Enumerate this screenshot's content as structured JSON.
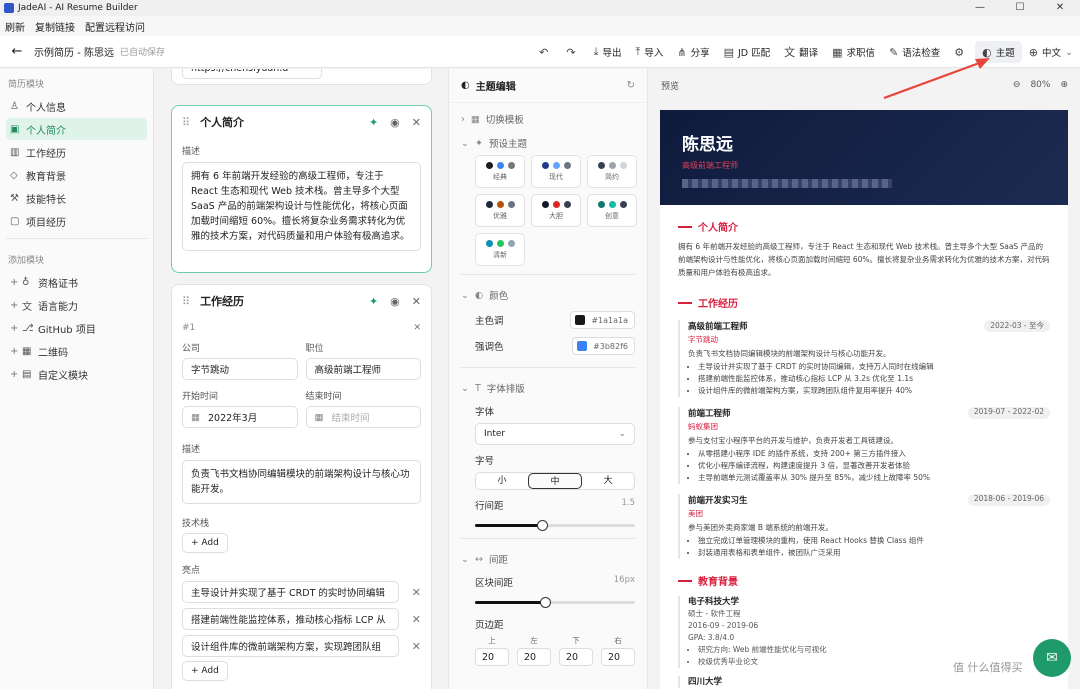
{
  "app": {
    "title": "JadeAI - AI Resume Builder",
    "menu": [
      "刷新",
      "复制链接",
      "配置远程访问"
    ]
  },
  "toolbar": {
    "doc_title": "示例简历 - 陈思远",
    "saved": "已自动保存",
    "undo_icon": "undo-icon",
    "redo_icon": "redo-icon",
    "buttons": [
      {
        "label": "导出",
        "icon": "export-icon"
      },
      {
        "label": "导入",
        "icon": "import-icon"
      },
      {
        "label": "分享",
        "icon": "share-icon"
      },
      {
        "label": "JD 匹配",
        "icon": "jd-match-icon"
      },
      {
        "label": "翻译",
        "icon": "translate-icon"
      },
      {
        "label": "求职信",
        "icon": "cover-letter-icon"
      },
      {
        "label": "语法检查",
        "icon": "grammar-icon"
      }
    ],
    "settings_icon": "settings-icon",
    "theme_label": "主题",
    "lang_label": "中文"
  },
  "sidebar": {
    "section1": "简历模块",
    "items": [
      "个人信息",
      "个人简介",
      "工作经历",
      "教育背景",
      "技能特长",
      "项目经历"
    ],
    "section2": "添加模块",
    "add_items": [
      "资格证书",
      "语言能力",
      "GitHub 项目",
      "二维码",
      "自定义模块"
    ]
  },
  "editor": {
    "top_input": "https://chensiyuan.d",
    "summary": {
      "title": "个人简介",
      "desc_label": "描述",
      "text": "拥有 6 年前端开发经验的高级工程师，专注于 React 生态和现代 Web 技术栈。曾主导多个大型 SaaS 产品的前端架构设计与性能优化，将核心页面加载时间缩短 60%。擅长将复杂业务需求转化为优雅的技术方案，对代码质量和用户体验有极高追求。"
    },
    "work": {
      "title": "工作经历",
      "index": "#1",
      "company_label": "公司",
      "company": "字节跳动",
      "position_label": "职位",
      "position": "高级前端工程师",
      "start_label": "开始时间",
      "start": "2022年3月",
      "end_label": "结束时间",
      "end_placeholder": "结束时间",
      "desc_label": "描述",
      "desc": "负责飞书文档协同编辑模块的前端架构设计与核心功能开发。",
      "tech_label": "技术栈",
      "add": "+ Add",
      "hl_label": "亮点",
      "highlights": [
        "主导设计并实现了基于 CRDT 的实时协同编辑",
        "搭建前端性能监控体系，推动核心指标 LCP 从",
        "设计组件库的微前端架构方案，实现跨团队组"
      ],
      "add2": "+ Add"
    }
  },
  "theme": {
    "title": "主题编辑",
    "switch_template": "切换模板",
    "preset_title": "预设主题",
    "presets": [
      {
        "name": "经典",
        "colors": [
          "#1a1a1a",
          "#3b82f6",
          "#777777"
        ]
      },
      {
        "name": "现代",
        "colors": [
          "#1e3a8a",
          "#60a5fa",
          "#6b7280"
        ]
      },
      {
        "name": "简约",
        "colors": [
          "#374151",
          "#9ca3af",
          "#d1d5db"
        ]
      },
      {
        "name": "优雅",
        "colors": [
          "#1f2937",
          "#b45309",
          "#6b7280"
        ]
      },
      {
        "name": "大胆",
        "colors": [
          "#111827",
          "#dc2626",
          "#374151"
        ]
      },
      {
        "name": "创意",
        "colors": [
          "#0f766e",
          "#14b8a6",
          "#374151"
        ]
      },
      {
        "name": "清新",
        "colors": [
          "#0891b2",
          "#22c55e",
          "#94a3b8"
        ]
      }
    ],
    "color_title": "颜色",
    "primary_label": "主色调",
    "primary": "#1a1a1a",
    "accent_label": "强调色",
    "accent": "#3b82f6",
    "typo_title": "字体排版",
    "font_label": "字体",
    "font": "Inter",
    "size_label": "字号",
    "sizes": [
      "小",
      "中",
      "大"
    ],
    "size_selected": 1,
    "lh_label": "行间距",
    "lh_value": "1.5",
    "lh_fraction": 0.42,
    "spacing_title": "间距",
    "block_label": "区块间距",
    "block_value": "16px",
    "block_fraction": 0.44,
    "margin_label": "页边距",
    "margins": [
      {
        "label": "上",
        "value": "20"
      },
      {
        "label": "左",
        "value": "20"
      },
      {
        "label": "下",
        "value": "20"
      },
      {
        "label": "右",
        "value": "20"
      }
    ]
  },
  "preview": {
    "label": "预览",
    "zoom": "80%",
    "name": "陈思远",
    "role": "高级前端工程师",
    "summary_title": "个人简介",
    "summary": "拥有 6 年前端开发经验的高级工程师，专注于 React 生态和现代 Web 技术栈。曾主导多个大型 SaaS 产品的前端架构设计与性能优化，将核心页面加载时间缩短 60%。擅长将复杂业务需求转化为优雅的技术方案，对代码质量和用户体验有极高追求。",
    "work_title": "工作经历",
    "jobs": [
      {
        "title": "高级前端工程师",
        "date": "2022-03 - 至今",
        "company": "字节跳动",
        "desc": "负责飞书文档协同编辑模块的前端架构设计与核心功能开发。",
        "items": [
          "主导设计并实现了基于 CRDT 的实时协同编辑，支持万人同时在线编辑",
          "搭建前端性能监控体系，推动核心指标 LCP 从 3.2s 优化至 1.1s",
          "设计组件库的微前端架构方案，实现跨团队组件复用率提升 40%"
        ]
      },
      {
        "title": "前端工程师",
        "date": "2019-07 - 2022-02",
        "company": "蚂蚁集团",
        "desc": "参与支付宝小程序平台的开发与维护，负责开发者工具链建设。",
        "items": [
          "从零搭建小程序 IDE 的插件系统，支持 200+ 第三方插件接入",
          "优化小程序编译流程，构建速度提升 3 倍，显著改善开发者体验",
          "主导前端单元测试覆盖率从 30% 提升至 85%，减少线上故障率 50%"
        ]
      },
      {
        "title": "前端开发实习生",
        "date": "2018-06 - 2019-06",
        "company": "美团",
        "desc": "参与美团外卖商家端 B 端系统的前端开发。",
        "items": [
          "独立完成订单管理模块的重构，使用 React Hooks 替换 Class 组件",
          "封装通用表格和表单组件，被团队广泛采用"
        ]
      }
    ],
    "edu_title": "教育背景",
    "edu": {
      "school": "电子科技大学",
      "degree": "硕士 - 软件工程",
      "date": "2016-09 - 2019-06",
      "gpa": "GPA: 3.8/4.0",
      "items": [
        "研究方向: Web 前端性能优化与可视化",
        "校级优秀毕业论文"
      ],
      "school2": "四川大学"
    }
  },
  "watermark": "值 什么值得买"
}
